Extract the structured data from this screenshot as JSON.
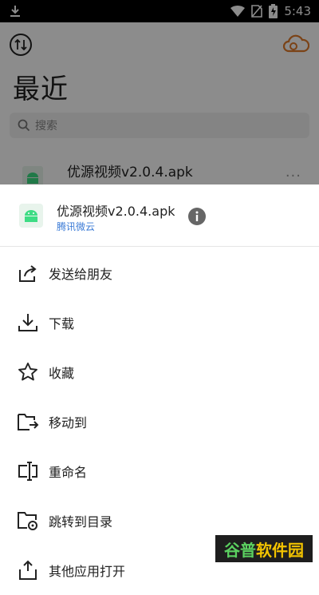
{
  "status_bar": {
    "time": "5:43",
    "icons": [
      "download-icon",
      "wifi-icon",
      "no-sim-icon",
      "battery-charging-icon"
    ]
  },
  "background": {
    "left_icon": "sort-icon",
    "right_icon": "cloud-icon",
    "title": "最近",
    "search_placeholder": "搜索",
    "recent_file": {
      "name": "优源视频v2.0.4.apk",
      "more": "···"
    }
  },
  "sheet": {
    "file_name": "优源视频v2.0.4.apk",
    "source": "腾讯微云",
    "info_icon": "info-icon",
    "items": [
      {
        "label": "发送给朋友",
        "icon": "share-icon"
      },
      {
        "label": "下载",
        "icon": "download-icon"
      },
      {
        "label": "收藏",
        "icon": "star-icon"
      },
      {
        "label": "移动到",
        "icon": "move-folder-icon"
      },
      {
        "label": "重命名",
        "icon": "rename-icon"
      },
      {
        "label": "跳转到目录",
        "icon": "folder-locate-icon"
      },
      {
        "label": "其他应用打开",
        "icon": "open-with-icon"
      }
    ]
  },
  "watermark": {
    "text_a": "谷普",
    "text_b": "软件园"
  },
  "colors": {
    "accent_blue": "#3b7bd6",
    "android_green": "#3ddc84",
    "overlay": "rgba(0,0,0,0.45)"
  }
}
